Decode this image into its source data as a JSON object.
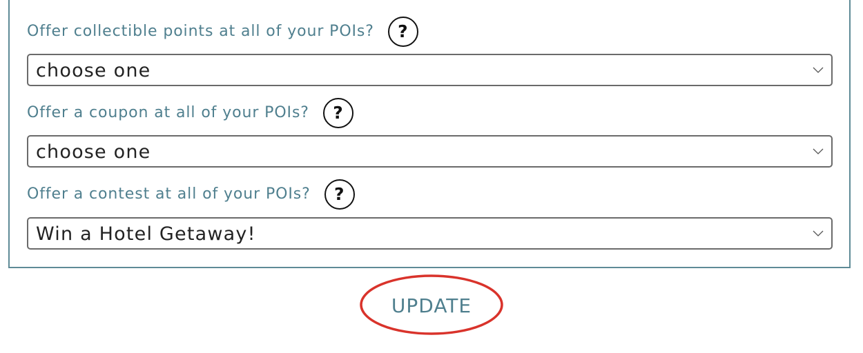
{
  "form": {
    "fields": [
      {
        "label": "Offer collectible points at all of your POIs?",
        "help": "?",
        "value": "choose one"
      },
      {
        "label": "Offer a coupon at all of your POIs?",
        "help": "?",
        "value": "choose one"
      },
      {
        "label": "Offer a contest at all of your POIs?",
        "help": "?",
        "value": "Win a Hotel Getaway!"
      }
    ]
  },
  "actions": {
    "update_label": "UPDATE"
  },
  "colors": {
    "label": "#4f7f8e",
    "panel_border": "#5e8a96",
    "highlight_circle": "#d9332b"
  },
  "icons": [
    "help-icon",
    "chevron-down-icon"
  ]
}
